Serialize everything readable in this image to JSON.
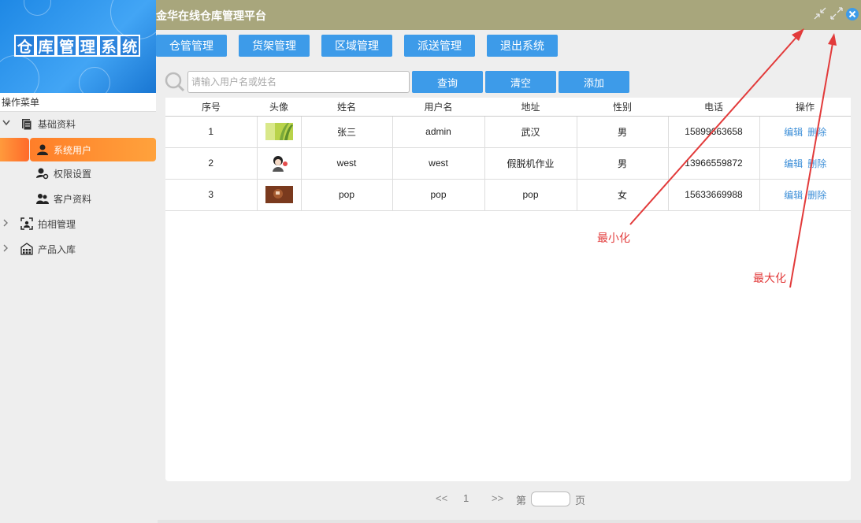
{
  "sidebar": {
    "logo_chars": [
      "仓",
      "库",
      "管",
      "理",
      "系",
      "统"
    ],
    "menu_title": "操作菜单",
    "groups": [
      {
        "label": "基础资料",
        "expanded": true,
        "icon": "document-icon",
        "children": [
          {
            "label": "系统用户",
            "icon": "user-icon",
            "active": true
          },
          {
            "label": "权限设置",
            "icon": "user-key-icon",
            "active": false
          },
          {
            "label": "客户资料",
            "icon": "users-icon",
            "active": false
          }
        ]
      },
      {
        "label": "拍相管理",
        "expanded": false,
        "icon": "camera-frame-icon"
      },
      {
        "label": "产品入库",
        "expanded": false,
        "icon": "warehouse-icon"
      }
    ]
  },
  "header": {
    "title": "金华在线仓库管理平台"
  },
  "nav": {
    "buttons": [
      "仓管管理",
      "货架管理",
      "区域管理",
      "派送管理",
      "退出系统"
    ]
  },
  "search": {
    "placeholder": "请输入用户名或姓名",
    "query_label": "查询",
    "clear_label": "清空",
    "add_label": "添加"
  },
  "table": {
    "columns": [
      "序号",
      "头像",
      "姓名",
      "用户名",
      "地址",
      "性别",
      "电话",
      "操作"
    ],
    "rows": [
      {
        "id": "1",
        "avatar": "green-leaf-avatar",
        "name": "张三",
        "username": "admin",
        "address": "武汉",
        "gender": "男",
        "phone": "15899663658",
        "edit": "编辑",
        "delete": "删除"
      },
      {
        "id": "2",
        "avatar": "cartoon-avatar",
        "name": "west",
        "username": "west",
        "address": "假脱机作业",
        "gender": "男",
        "phone": "13966559872",
        "edit": "编辑",
        "delete": "删除"
      },
      {
        "id": "3",
        "avatar": "brown-avatar",
        "name": "pop",
        "username": "pop",
        "address": "pop",
        "gender": "女",
        "phone": "15633669988",
        "edit": "编辑",
        "delete": "删除"
      }
    ]
  },
  "pagination": {
    "prev": "<<",
    "current_page": "1",
    "next": ">>",
    "go_prefix": "第",
    "go_suffix": "页"
  },
  "annotations": {
    "minimize_label": "最小化",
    "maximize_label": "最大化",
    "arrow_color": "#e23a3a"
  },
  "colors": {
    "header_bg": "#a8a67c",
    "button_bg": "#3d9be9",
    "active_menu": "#ff8c32"
  }
}
